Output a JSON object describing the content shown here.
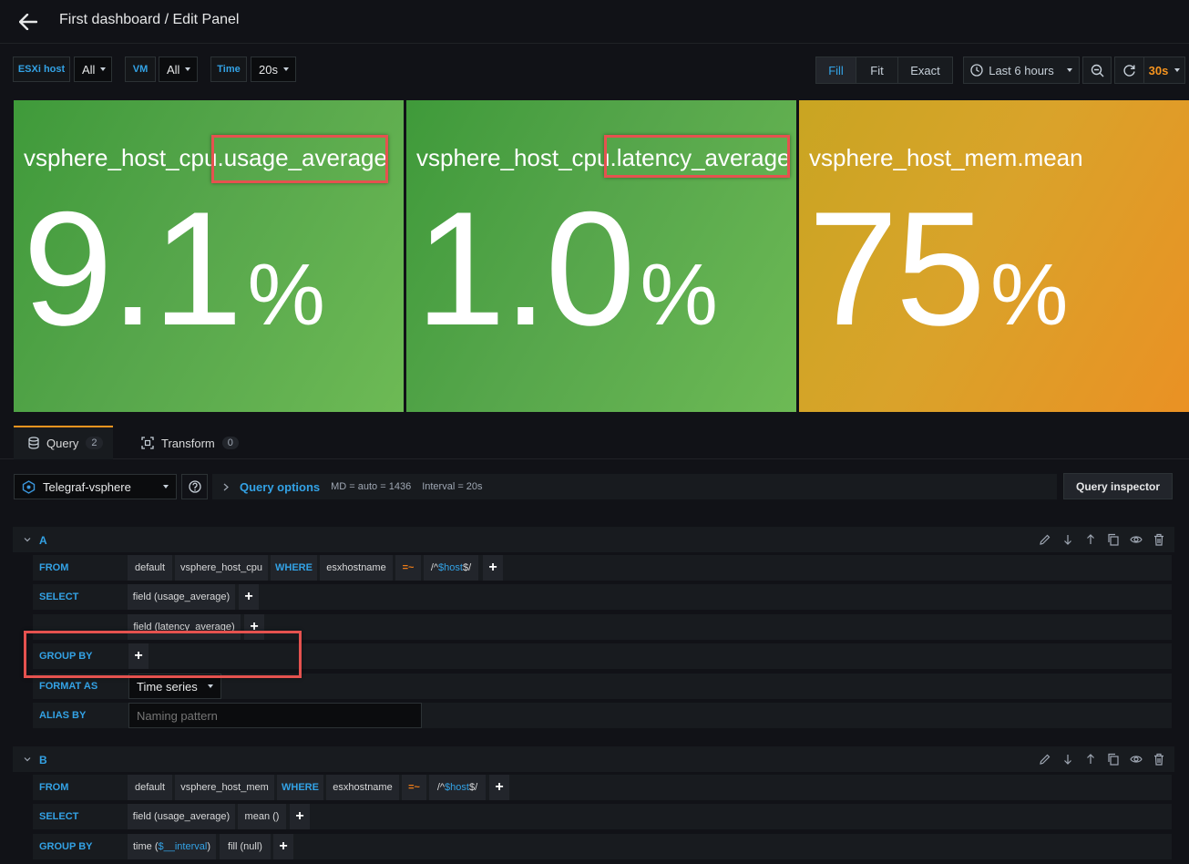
{
  "header": {
    "title": "First dashboard / Edit Panel"
  },
  "variables": [
    {
      "label": "ESXi host",
      "value": "All"
    },
    {
      "label": "VM",
      "value": "All"
    },
    {
      "label": "Time",
      "value": "20s"
    }
  ],
  "toolbar": {
    "fill": "Fill",
    "fit": "Fit",
    "exact": "Exact",
    "time_range": "Last 6 hours",
    "refresh_interval": "30s",
    "accent": "#f6941f"
  },
  "panels": [
    {
      "title_prefix": "vsphere_host_cpu",
      "title_suffix": ".usage_average",
      "value": "9.1",
      "unit": "%",
      "color": "#56a64b"
    },
    {
      "title_prefix": "vsphere_host_cpu",
      "title_suffix": ".latency_average",
      "value": "1.0",
      "unit": "%",
      "color": "#56a64b"
    },
    {
      "title_prefix": "vsphere_host_mem",
      "title_suffix": ".mean",
      "value": "75",
      "unit": "%",
      "color": "#e5a33b"
    }
  ],
  "tabs": [
    {
      "label": "Query",
      "count": "2"
    },
    {
      "label": "Transform",
      "count": "0"
    }
  ],
  "datasource": {
    "name": "Telegraf-vsphere"
  },
  "query_options": {
    "label": "Query options",
    "md": "MD = auto = 1436",
    "interval": "Interval = 20s"
  },
  "query_inspector": "Query inspector",
  "query_a": {
    "name": "A",
    "from_label": "FROM",
    "from_db": "default",
    "from_measurement": "vsphere_host_cpu",
    "where": "WHERE",
    "where_key": "esxhostname",
    "where_op": "=~",
    "where_val_pre": "/^",
    "where_val_var": "$host",
    "where_val_post": "$/",
    "select_label": "SELECT",
    "select_1": "field (usage_average)",
    "select_2": "field (latency_average)",
    "groupby_label": "GROUP BY",
    "format_label": "FORMAT AS",
    "format_value": "Time series",
    "alias_label": "ALIAS BY",
    "alias_placeholder": "Naming pattern"
  },
  "query_b": {
    "name": "B",
    "from_label": "FROM",
    "from_db": "default",
    "from_measurement": "vsphere_host_mem",
    "where": "WHERE",
    "where_key": "esxhostname",
    "where_op": "=~",
    "where_val_pre": "/^",
    "where_val_var": "$host",
    "where_val_post": "$/",
    "select_label": "SELECT",
    "select_1": "field (usage_average)",
    "select_2": "mean ()",
    "groupby_label": "GROUP BY",
    "groupby_time_pre": "time (",
    "groupby_time_var": "$__interval",
    "groupby_time_post": ")",
    "groupby_fill": "fill (null)"
  }
}
